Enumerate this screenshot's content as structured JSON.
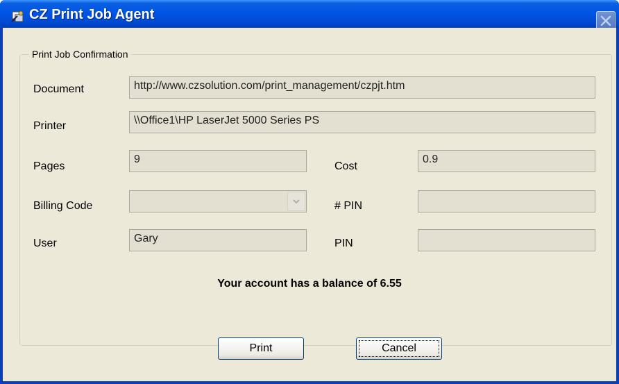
{
  "window": {
    "title": "CZ Print Job Agent",
    "app_icon": "print-agent-icon",
    "close_icon": "close-icon"
  },
  "group": {
    "title": "Print Job Confirmation"
  },
  "fields": {
    "document": {
      "label": "Document",
      "value": "http://www.czsolution.com/print_management/czpjt.htm"
    },
    "printer": {
      "label": "Printer",
      "value": "\\\\Office1\\HP LaserJet 5000 Series PS"
    },
    "pages": {
      "label": "Pages",
      "value": "9"
    },
    "cost": {
      "label": "Cost",
      "value": "0.9"
    },
    "billing_code": {
      "label": "Billing Code",
      "value": ""
    },
    "num_pin": {
      "label": "# PIN",
      "value": ""
    },
    "user": {
      "label": "User",
      "value": "Gary"
    },
    "pin": {
      "label": "PIN",
      "value": ""
    }
  },
  "balance_message": "Your account has a balance of 6.55",
  "buttons": {
    "print": "Print",
    "cancel": "Cancel"
  },
  "colors": {
    "title_bar": "#0055e5",
    "dialog_bg": "#ece9d8",
    "field_bg": "#e3e0d2"
  }
}
